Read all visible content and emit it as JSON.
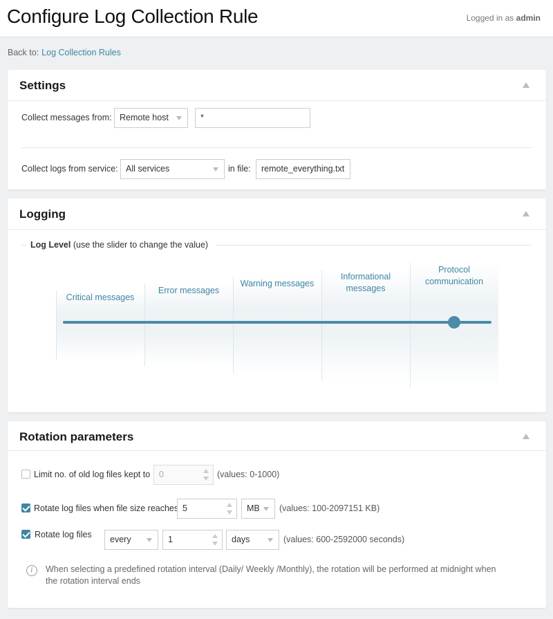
{
  "header": {
    "title": "Configure Log Collection Rule",
    "logged_in_prefix": "Logged in as",
    "user": "admin"
  },
  "breadcrumb": {
    "prefix": "Back to:",
    "link": "Log Collection Rules"
  },
  "settings": {
    "title": "Settings",
    "collect_from_label": "Collect messages from:",
    "collect_from_value": "Remote host",
    "host_value": "*",
    "service_label": "Collect logs from service:",
    "service_value": "All services",
    "file_label": "in file:",
    "file_value": "remote_everything.txt"
  },
  "logging": {
    "title": "Logging",
    "log_level_label": "Log Level",
    "log_level_hint": "(use the slider to change the value)",
    "levels": [
      {
        "label": "Critical messages"
      },
      {
        "label": "Error messages"
      },
      {
        "label": "Warning messages"
      },
      {
        "label": "Informational messages"
      },
      {
        "label": "Protocol communication"
      }
    ],
    "selected_level": "Protocol communication",
    "selected_index": 4
  },
  "rotation": {
    "title": "Rotation parameters",
    "limit_files": {
      "checked": false,
      "label": "Limit no. of old log files kept to",
      "value": "0",
      "hint": "(values: 0-1000)"
    },
    "size": {
      "checked": true,
      "label": "Rotate log files when file size reaches",
      "value": "5",
      "unit": "MB",
      "hint": "(values: 100-2097151 KB)"
    },
    "interval": {
      "checked": true,
      "label": "Rotate log files",
      "mode": "every",
      "value": "1",
      "unit": "days",
      "hint": "(values: 600-2592000 seconds)"
    },
    "info_icon": "info-icon",
    "info_text": "When selecting a predefined rotation interval (Daily/ Weekly /Monthly), the rotation will be performed at midnight when the rotation interval ends"
  }
}
